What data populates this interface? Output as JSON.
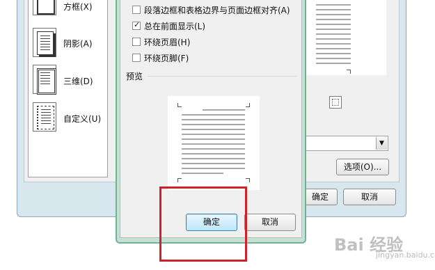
{
  "back_dialog": {
    "settings": [
      {
        "label": "方框(X)",
        "icon": "box-border-icon"
      },
      {
        "label": "阴影(A)",
        "icon": "shadow-border-icon"
      },
      {
        "label": "三维(D)",
        "icon": "3d-border-icon"
      },
      {
        "label": "自定义(U)",
        "icon": "custom-border-icon"
      }
    ],
    "options_button": "选项(O)...",
    "ok_button": "确定",
    "cancel_button": "取消"
  },
  "options_dialog": {
    "checkboxes": [
      {
        "label": "段落边框和表格边界与页面边框对齐(A)",
        "checked": false
      },
      {
        "label": "总在前面显示(L)",
        "checked": true
      },
      {
        "label": "环绕页眉(H)",
        "checked": false
      },
      {
        "label": "环绕页脚(F)",
        "checked": false
      }
    ],
    "preview_label": "预览",
    "ok_button": "确定",
    "cancel_button": "取消"
  },
  "watermark": {
    "text": "Bai 经验",
    "sub": "jingyan.baidu.com"
  },
  "colors": {
    "highlight": "#d0202a",
    "front_frame": "#6fb393"
  }
}
